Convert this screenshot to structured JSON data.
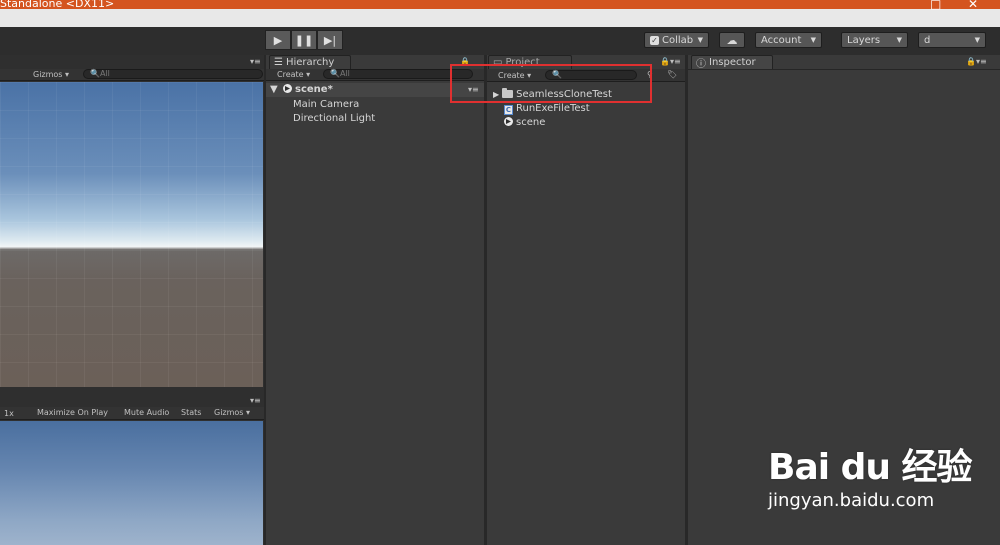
{
  "window": {
    "title": "Standalone <DX11>",
    "minimize": "–",
    "maximize": "□",
    "close": "✕"
  },
  "toolbar": {
    "play_icon": "play-icon",
    "pause_icon": "pause-icon",
    "step_icon": "step-icon",
    "collab": "Collab",
    "account": "Account",
    "layers": "Layers",
    "layout": "d"
  },
  "scene": {
    "gizmos": "Gizmos",
    "search_placeholder": "All"
  },
  "game": {
    "scale": "1x",
    "maximize_on_play": "Maximize On Play",
    "mute_audio": "Mute Audio",
    "stats": "Stats",
    "gizmos": "Gizmos"
  },
  "hierarchy": {
    "tab": "Hierarchy",
    "create": "Create",
    "search_placeholder": "All",
    "scene_name": "scene*",
    "items": [
      "Main Camera",
      "Directional Light"
    ]
  },
  "project": {
    "tab": "Project",
    "create": "Create",
    "items": [
      {
        "name": "SeamlessCloneTest",
        "icon": "folder-icon"
      },
      {
        "name": "RunExeFileTest",
        "icon": "csharp-script-icon"
      },
      {
        "name": "scene",
        "icon": "unity-scene-icon"
      }
    ]
  },
  "inspector": {
    "tab": "Inspector"
  },
  "watermark": {
    "logo": "Bai  du 经验",
    "url": "jingyan.baidu.com"
  },
  "colors": {
    "accent_titlebar": "#d4541f",
    "highlight_box": "#e03030",
    "panel_bg": "#393939"
  }
}
